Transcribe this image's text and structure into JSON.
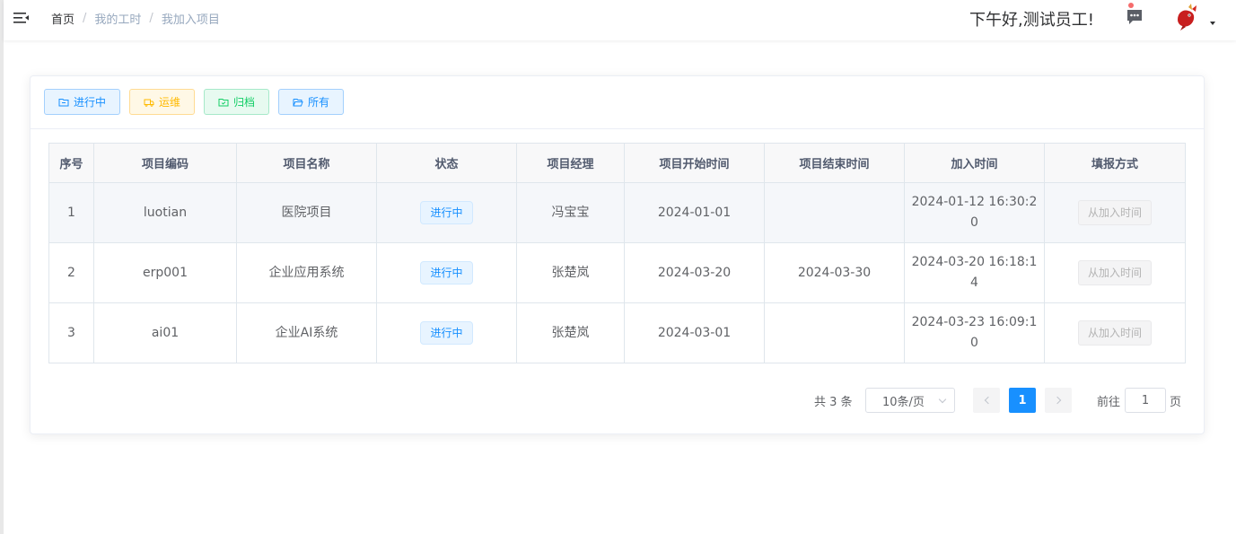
{
  "breadcrumb": [
    "首页",
    "我的工时",
    "我加入项目"
  ],
  "header": {
    "greeting": "下午好,测试员工!"
  },
  "filters": [
    {
      "label": "进行中",
      "icon": "folder-icon"
    },
    {
      "label": "运维",
      "icon": "truck-icon"
    },
    {
      "label": "归档",
      "icon": "archive-icon"
    },
    {
      "label": "所有",
      "icon": "folder-open-icon"
    }
  ],
  "table": {
    "columns": [
      "序号",
      "项目编码",
      "项目名称",
      "状态",
      "项目经理",
      "项目开始时间",
      "项目结束时间",
      "加入时间",
      "填报方式"
    ],
    "rows": [
      {
        "index": "1",
        "code": "luotian",
        "name": "医院项目",
        "status": "进行中",
        "manager": "冯宝宝",
        "start": "2024-01-01",
        "end": "",
        "joined_date": "2024-01-12 16:30:2",
        "joined_tail": "0",
        "method": "从加入时间"
      },
      {
        "index": "2",
        "code": "erp001",
        "name": "企业应用系统",
        "status": "进行中",
        "manager": "张楚岚",
        "start": "2024-03-20",
        "end": "2024-03-30",
        "joined_date": "2024-03-20 16:18:1",
        "joined_tail": "4",
        "method": "从加入时间"
      },
      {
        "index": "3",
        "code": "ai01",
        "name": "企业AI系统",
        "status": "进行中",
        "manager": "张楚岚",
        "start": "2024-03-01",
        "end": "",
        "joined_date": "2024-03-23 16:09:1",
        "joined_tail": "0",
        "method": "从加入时间"
      }
    ]
  },
  "pagination": {
    "total": "共 3 条",
    "page_size": "10条/页",
    "current_page": "1",
    "goto_label": "前往",
    "goto_value": "1",
    "goto_suffix": "页"
  },
  "colors": {
    "primary": "#1890ff",
    "warning": "#ffba00",
    "success": "#13ce66"
  }
}
